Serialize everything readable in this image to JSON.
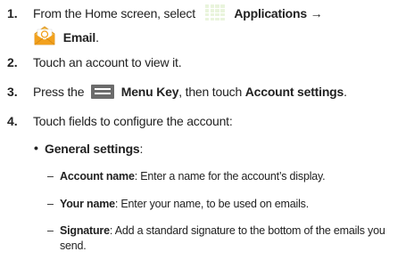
{
  "steps": [
    {
      "num": "1.",
      "text_a": "From the Home screen, select",
      "bold_a": "Applications →",
      "bold_b": "Email",
      "text_b": "."
    },
    {
      "num": "2.",
      "text": "Touch an account to view it."
    },
    {
      "num": "3.",
      "text_a": "Press the",
      "bold_a": "Menu Key",
      "text_b": ", then touch",
      "bold_b": "Account settings",
      "text_c": "."
    },
    {
      "num": "4.",
      "text": "Touch fields to configure the account:"
    }
  ],
  "general": {
    "bullet": "•",
    "label": "General settings",
    "colon": ":"
  },
  "items": [
    {
      "dash": "–",
      "label": "Account name",
      "desc": ": Enter a name for the account’s display."
    },
    {
      "dash": "–",
      "label": "Your name",
      "desc": ": Enter your name, to be used on emails."
    },
    {
      "dash": "–",
      "label": "Signature",
      "desc": ": Add a standard signature to the bottom of the emails you",
      "desc2": "send."
    }
  ],
  "icons": {
    "apps": "applications-grid-icon",
    "email": "email-envelope-icon",
    "menu": "menu-key-icon"
  },
  "colors": {
    "apps_green": "#5aa02a",
    "email_orange": "#f2a11e",
    "menu_gray": "#6b6b6b"
  }
}
